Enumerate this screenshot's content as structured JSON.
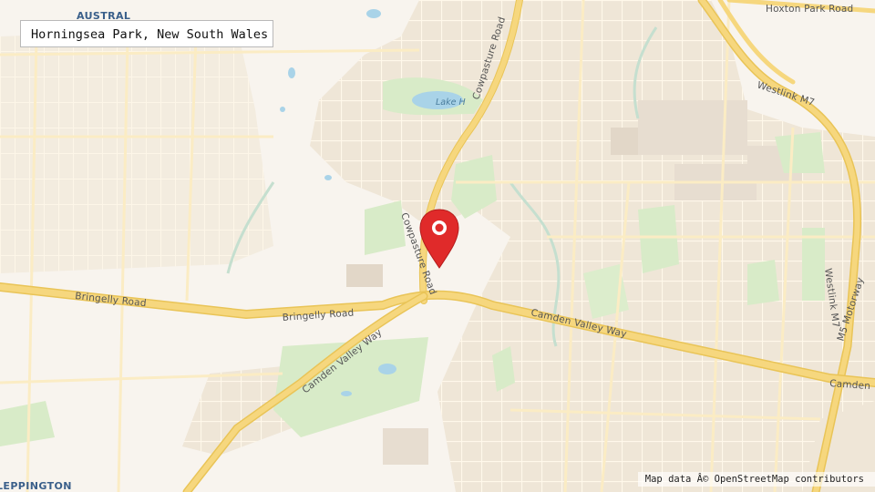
{
  "location_title": "Horningsea Park, New South Wales",
  "attribution": "Map data Â© OpenStreetMap contributors",
  "place_labels": {
    "austral": "AUSTRAL",
    "leppington": "LEPPINGTON"
  },
  "water_labels": {
    "lake": "Lake H"
  },
  "road_labels": {
    "hoxton_park_road": "Hoxton Park Road",
    "westlink_m7_top": "Westlink M7",
    "westlink_m7_right": "Westlink M7",
    "m5_motorway": "M5 Motorway",
    "cowpasture_road_north": "Cowpasture Road",
    "cowpasture_road_south": "Cowpasture Road",
    "bringelly_road_west": "Bringelly Road",
    "bringelly_road_east": "Bringelly Road",
    "camden_valley_way_sw": "Camden Valley Way",
    "camden_valley_way_east": "Camden Valley Way",
    "camden_edge": "Camden"
  },
  "colors": {
    "land": "#f8f4ee",
    "residential": "#efe6d7",
    "park": "#d8ebc8",
    "water": "#a9d3e8",
    "major_road": "#f6d77e",
    "minor_road": "#fbecc4",
    "marker": "#e02a2a"
  },
  "marker_icon": "map-pin-icon"
}
